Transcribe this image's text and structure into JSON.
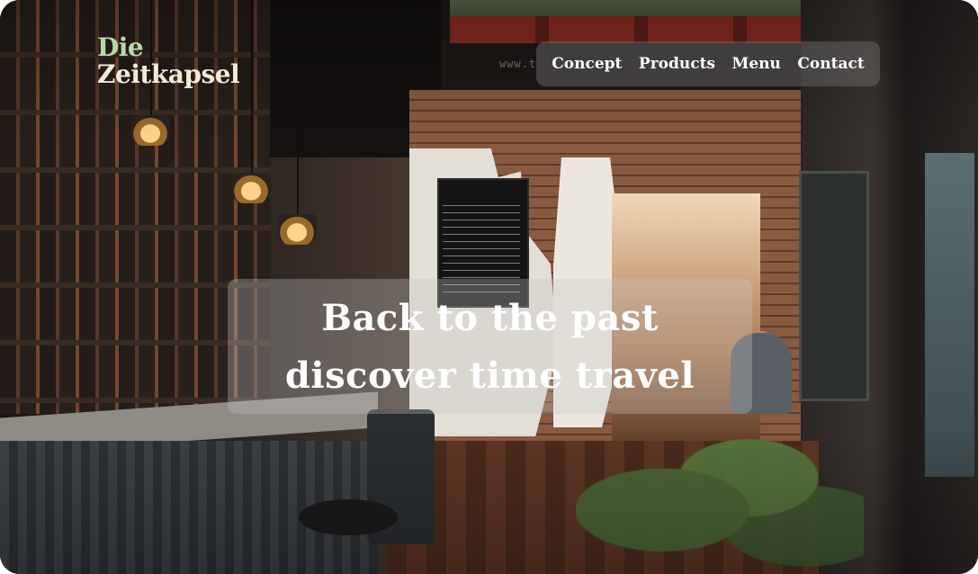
{
  "brand": {
    "line1": "Die",
    "line2": "Zeitkapsel",
    "line1_color": "#b8d8a8",
    "line2_color": "#f2ead6"
  },
  "background_text": "www.t",
  "nav": {
    "items": [
      {
        "label": "Concept"
      },
      {
        "label": "Products"
      },
      {
        "label": "Menu"
      },
      {
        "label": "Contact"
      }
    ]
  },
  "hero": {
    "line1": "Back to the past",
    "line2": "discover time travel"
  },
  "colors": {
    "text": "#ffffff",
    "nav_bg": "rgba(120,120,120,0.42)",
    "hero_bg": "rgba(200,200,200,0.32)"
  }
}
